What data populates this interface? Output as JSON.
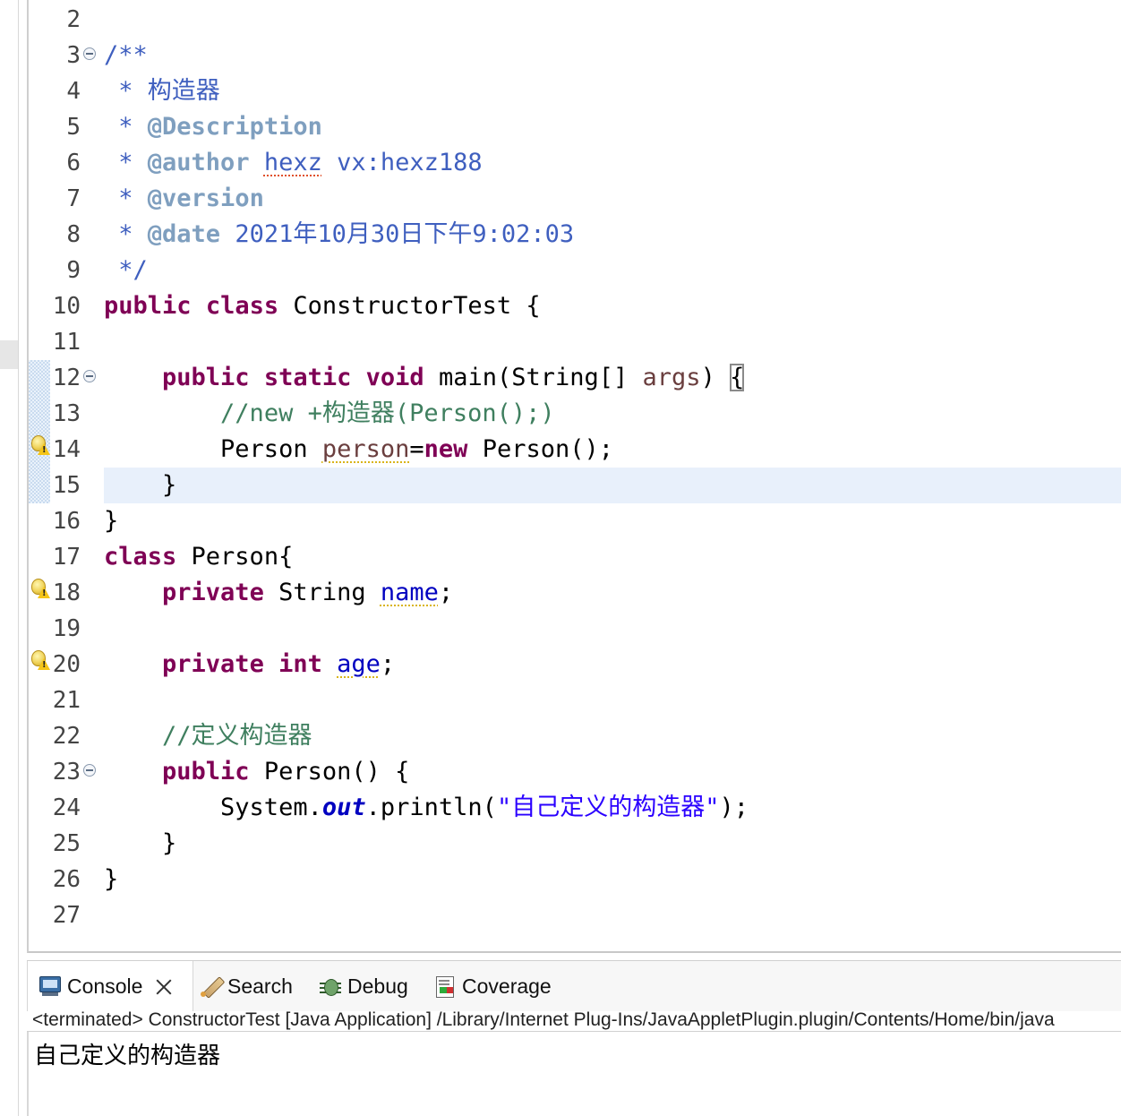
{
  "editor": {
    "lines": [
      {
        "n": "2"
      },
      {
        "n": "3",
        "t": [
          {
            "c": "jd",
            "v": "/**"
          }
        ]
      },
      {
        "n": "4",
        "t": [
          {
            "c": "jd",
            "v": " * 构造器"
          }
        ]
      },
      {
        "n": "5",
        "t": [
          {
            "c": "jd",
            "v": " * "
          },
          {
            "c": "jt",
            "v": "@Description"
          }
        ]
      },
      {
        "n": "6",
        "t": [
          {
            "c": "jd",
            "v": " * "
          },
          {
            "c": "jt",
            "v": "@author"
          },
          {
            "c": "jd",
            "v": " "
          },
          {
            "c": "jd sq-red",
            "v": "hexz"
          },
          {
            "c": "jd",
            "v": " vx:hexz188"
          }
        ]
      },
      {
        "n": "7",
        "t": [
          {
            "c": "jd",
            "v": " * "
          },
          {
            "c": "jt",
            "v": "@version"
          }
        ]
      },
      {
        "n": "8",
        "t": [
          {
            "c": "jd",
            "v": " * "
          },
          {
            "c": "jt",
            "v": "@date"
          },
          {
            "c": "jd",
            "v": " 2021年10月30日下午9:02:03"
          }
        ]
      },
      {
        "n": "9",
        "t": [
          {
            "c": "jd",
            "v": " */"
          }
        ]
      },
      {
        "n": "10",
        "t": [
          {
            "c": "kw",
            "v": "public"
          },
          {
            "c": "",
            "v": " "
          },
          {
            "c": "kw",
            "v": "class"
          },
          {
            "c": "",
            "v": " ConstructorTest {"
          }
        ]
      },
      {
        "n": "11"
      },
      {
        "n": "12",
        "t": [
          {
            "c": "",
            "v": "    "
          },
          {
            "c": "kw",
            "v": "public"
          },
          {
            "c": "",
            "v": " "
          },
          {
            "c": "kw",
            "v": "static"
          },
          {
            "c": "",
            "v": " "
          },
          {
            "c": "kw",
            "v": "void"
          },
          {
            "c": "",
            "v": " main(String[] "
          },
          {
            "c": "arg",
            "v": "args"
          },
          {
            "c": "",
            "v": ") "
          },
          {
            "c": "bracket",
            "v": "{"
          }
        ]
      },
      {
        "n": "13",
        "t": [
          {
            "c": "",
            "v": "        "
          },
          {
            "c": "cm",
            "v": "//new +构造器(Person();)"
          }
        ]
      },
      {
        "n": "14",
        "t": [
          {
            "c": "",
            "v": "        Person "
          },
          {
            "c": "sq-yel arg",
            "v": "person"
          },
          {
            "c": "",
            "v": "="
          },
          {
            "c": "kw",
            "v": "new"
          },
          {
            "c": "",
            "v": " Person();"
          }
        ]
      },
      {
        "n": "15",
        "t": [
          {
            "c": "",
            "v": "    }"
          }
        ]
      },
      {
        "n": "16",
        "t": [
          {
            "c": "",
            "v": "}"
          }
        ]
      },
      {
        "n": "17",
        "t": [
          {
            "c": "kw",
            "v": "class"
          },
          {
            "c": "",
            "v": " Person{"
          }
        ]
      },
      {
        "n": "18",
        "t": [
          {
            "c": "",
            "v": "    "
          },
          {
            "c": "kw",
            "v": "private"
          },
          {
            "c": "",
            "v": " String "
          },
          {
            "c": "fld sq-yel",
            "v": "name"
          },
          {
            "c": "",
            "v": ";"
          }
        ]
      },
      {
        "n": "19"
      },
      {
        "n": "20",
        "t": [
          {
            "c": "",
            "v": "    "
          },
          {
            "c": "kw",
            "v": "private"
          },
          {
            "c": "",
            "v": " "
          },
          {
            "c": "kw",
            "v": "int"
          },
          {
            "c": "",
            "v": " "
          },
          {
            "c": "fld sq-yel",
            "v": "age"
          },
          {
            "c": "",
            "v": ";"
          }
        ]
      },
      {
        "n": "21"
      },
      {
        "n": "22",
        "t": [
          {
            "c": "",
            "v": "    "
          },
          {
            "c": "cm",
            "v": "//定义构造器"
          }
        ]
      },
      {
        "n": "23",
        "t": [
          {
            "c": "",
            "v": "    "
          },
          {
            "c": "kw",
            "v": "public"
          },
          {
            "c": "",
            "v": " Person() {"
          }
        ]
      },
      {
        "n": "24",
        "t": [
          {
            "c": "",
            "v": "        System."
          },
          {
            "c": "static-fld",
            "v": "out"
          },
          {
            "c": "",
            "v": ".println("
          },
          {
            "c": "st",
            "v": "\"自己定义的构造器\""
          },
          {
            "c": "",
            "v": ");"
          }
        ]
      },
      {
        "n": "25",
        "t": [
          {
            "c": "",
            "v": "    }"
          }
        ]
      },
      {
        "n": "26",
        "t": [
          {
            "c": "",
            "v": "}"
          }
        ]
      },
      {
        "n": "27"
      }
    ],
    "fold_lines": [
      "3",
      "12",
      "23"
    ],
    "warning_lines": [
      "14",
      "18",
      "20"
    ],
    "highlight_line": "15"
  },
  "console_tabs": {
    "console": "Console",
    "search": "Search",
    "debug": "Debug",
    "coverage": "Coverage"
  },
  "console": {
    "header": "<terminated> ConstructorTest [Java Application] /Library/Internet Plug-Ins/JavaAppletPlugin.plugin/Contents/Home/bin/java",
    "output": "自己定义的构造器"
  }
}
